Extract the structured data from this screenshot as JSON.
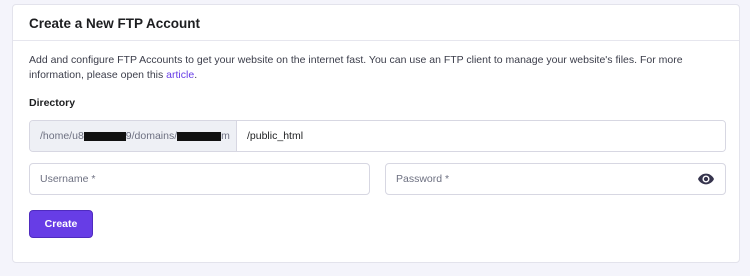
{
  "card": {
    "title": "Create a New FTP Account",
    "description_text": "Add and configure FTP Accounts to get your website on the internet fast. You can use an FTP client to manage your website's files. For more information, please open this ",
    "description_link": "article",
    "description_end": "."
  },
  "directory": {
    "label": "Directory",
    "prefix_part1": "/home/u8",
    "prefix_part2": "9/domains/",
    "prefix_part3": "m",
    "value": "/public_html"
  },
  "username": {
    "placeholder": "Username *",
    "value": ""
  },
  "password": {
    "placeholder": "Password *",
    "value": ""
  },
  "actions": {
    "create_label": "Create"
  },
  "colors": {
    "accent": "#673de6",
    "background": "#f4f4fb",
    "redaction": "#111111"
  },
  "icons": {
    "password_toggle": "eye-icon"
  }
}
